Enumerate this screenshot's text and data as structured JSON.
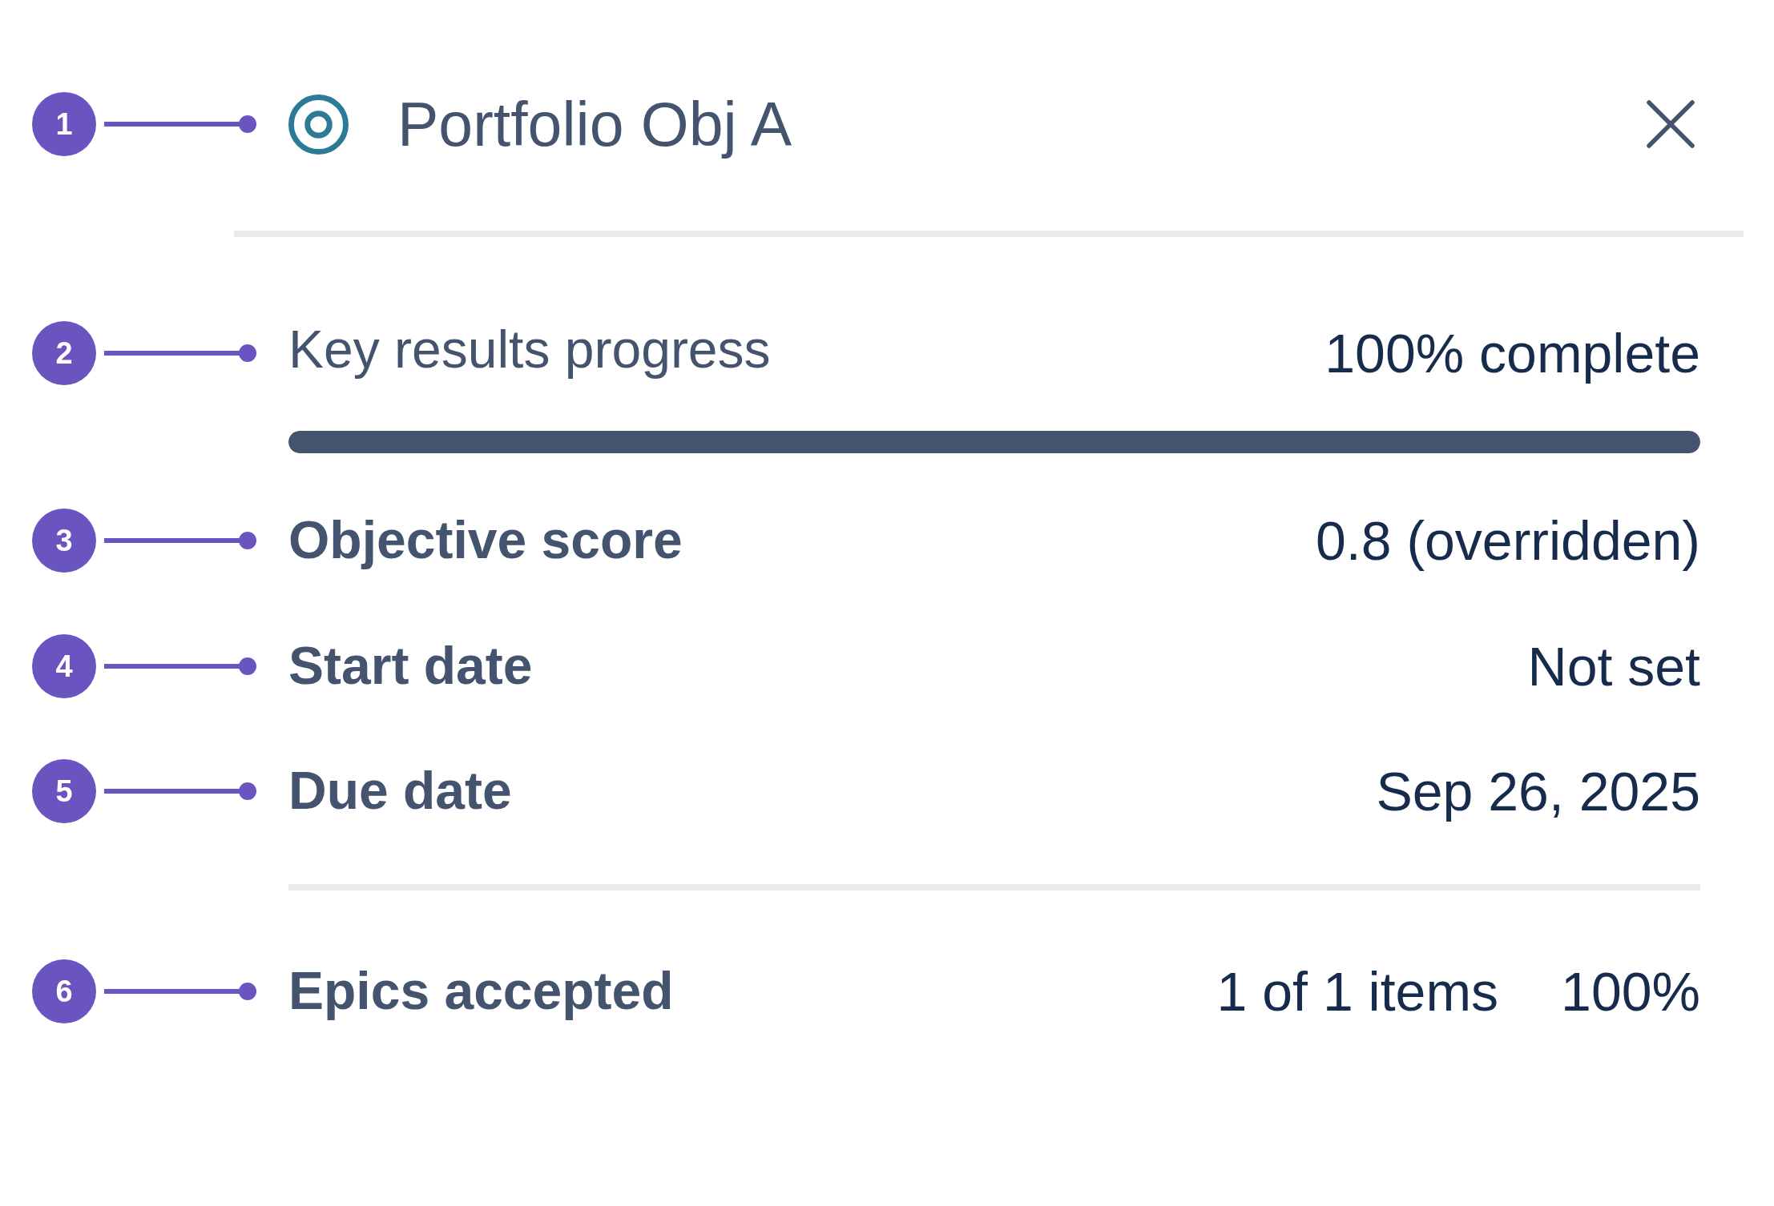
{
  "header": {
    "callout": "1",
    "title": "Portfolio Obj A"
  },
  "key_results": {
    "callout": "2",
    "label": "Key results progress",
    "reading": "100% complete",
    "level": 1
  },
  "fields": [
    {
      "callout": "3",
      "label": "Objective score",
      "value": "0.8 (overridden)"
    },
    {
      "callout": "4",
      "label": "Start date",
      "value": "Not set"
    },
    {
      "callout": "5",
      "label": "Due date",
      "value": "Sep 26, 2025"
    }
  ],
  "epics": {
    "callout": "6",
    "label": "Epics accepted",
    "count": "1 of 1 items",
    "percent": "100%"
  }
}
